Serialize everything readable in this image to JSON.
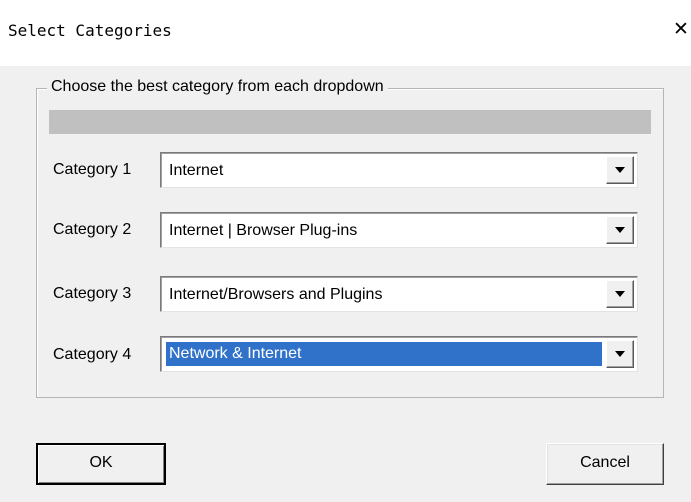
{
  "window": {
    "title": "Select Categories",
    "close_glyph": "✕"
  },
  "group": {
    "legend": "Choose the best category from each dropdown"
  },
  "categories": [
    {
      "label": "Category 1",
      "value": "Internet"
    },
    {
      "label": "Category 2",
      "value": "Internet | Browser Plug-ins"
    },
    {
      "label": "Category 3",
      "value": "Internet/Browsers and Plugins"
    },
    {
      "label": "Category 4",
      "value": "Network & Internet"
    }
  ],
  "buttons": {
    "ok": "OK",
    "cancel": "Cancel"
  },
  "colors": {
    "selection": "#3072c9",
    "progress_fill": "#c0c0c0"
  },
  "icons": {
    "close": "close-icon",
    "dropdown": "chevron-down-icon"
  }
}
